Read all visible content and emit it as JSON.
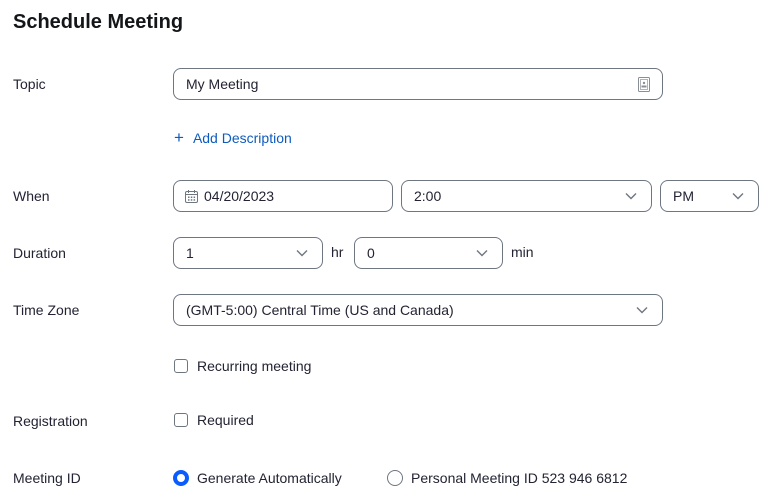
{
  "page": {
    "title": "Schedule Meeting"
  },
  "topic": {
    "label": "Topic",
    "value": "My Meeting"
  },
  "description": {
    "link_label": "Add Description",
    "icon": "plus-icon"
  },
  "when": {
    "label": "When",
    "date": "04/20/2023",
    "time": "2:00",
    "ampm": "PM"
  },
  "duration": {
    "label": "Duration",
    "hours": "1",
    "hours_unit": "hr",
    "minutes": "0",
    "minutes_unit": "min"
  },
  "timezone": {
    "label": "Time Zone",
    "value": "(GMT-5:00) Central Time (US and Canada)"
  },
  "recurring": {
    "label": "Recurring meeting",
    "checked": false
  },
  "registration": {
    "label": "Registration",
    "option_label": "Required",
    "checked": false
  },
  "meeting_id": {
    "label": "Meeting ID",
    "options": [
      {
        "label": "Generate Automatically",
        "selected": true
      },
      {
        "label": "Personal Meeting ID 523 946 6812",
        "selected": false
      }
    ]
  },
  "colors": {
    "accent": "#0b5cff",
    "link": "#0e5bbf",
    "border": "#6e7680",
    "text": "#232333"
  }
}
